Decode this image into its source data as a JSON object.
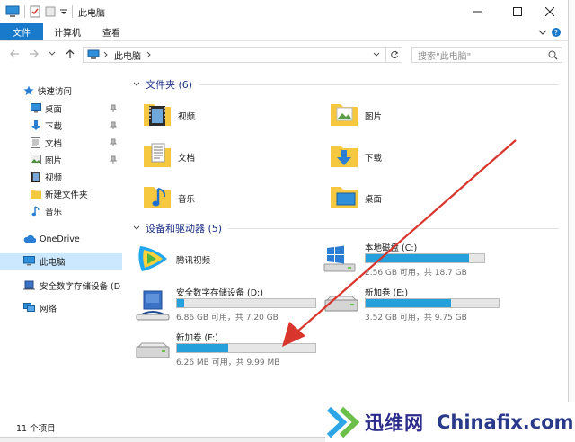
{
  "window": {
    "title": "此电脑"
  },
  "ribbon": {
    "tabs": [
      "文件",
      "计算机",
      "查看"
    ]
  },
  "address": {
    "path": "此电脑",
    "search_placeholder": "搜索\"此电脑\""
  },
  "nav": {
    "quick_access": "快速访问",
    "items": [
      {
        "label": "桌面",
        "pinned": true
      },
      {
        "label": "下载",
        "pinned": true
      },
      {
        "label": "文档",
        "pinned": true
      },
      {
        "label": "图片",
        "pinned": true
      },
      {
        "label": "视频",
        "pinned": false
      },
      {
        "label": "新建文件夹",
        "pinned": false
      },
      {
        "label": "音乐",
        "pinned": false
      }
    ],
    "onedrive": "OneDrive",
    "this_pc": "此电脑",
    "secure_device": "安全数字存储设备 (D",
    "network": "网络"
  },
  "folders": {
    "header": "文件夹 (6)",
    "items": [
      "视频",
      "图片",
      "文档",
      "下载",
      "音乐",
      "桌面"
    ]
  },
  "drives": {
    "header": "设备和驱动器 (5)",
    "items": [
      {
        "name": "腾讯视频",
        "usage": null,
        "capacity": ""
      },
      {
        "name": "本地磁盘 (C:)",
        "usage": 0.87,
        "capacity": "2.56 GB 可用，共 18.7 GB"
      },
      {
        "name": "安全数字存储设备 (D:)",
        "usage": 0.05,
        "capacity": "6.86 GB 可用，共 7.20 GB"
      },
      {
        "name": "新加卷 (E:)",
        "usage": 0.64,
        "capacity": "3.52 GB 可用，共 9.75 GB"
      },
      {
        "name": "新加卷 (F:)",
        "usage": 0.37,
        "capacity": "6.26 MB 可用，共 9.99 MB"
      }
    ]
  },
  "status": {
    "count": "11 个项目"
  },
  "watermark": {
    "cn": "迅维网",
    "en": "Chinafix.com"
  },
  "colors": {
    "accent": "#1979ca",
    "bar_fill": "#26a0da",
    "header_blue": "#1e3287",
    "folder_yellow": "#f5c83f",
    "arrow_red": "#d8352d"
  }
}
